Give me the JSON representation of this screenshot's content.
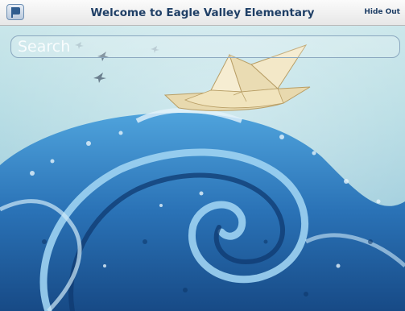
{
  "header": {
    "title": "Welcome to Eagle Valley Elementary",
    "hide_out_label": "Hide Out",
    "menu_icon": "flag-icon"
  },
  "search": {
    "placeholder": "Search"
  },
  "colors": {
    "topbar": "#e7e7e7",
    "title_text": "#1f3f66",
    "sky": "#b7dde4",
    "wave_dark": "#1d4f8c",
    "wave_light": "#5fb3e6",
    "paper_boat": "#f2e7c8"
  }
}
